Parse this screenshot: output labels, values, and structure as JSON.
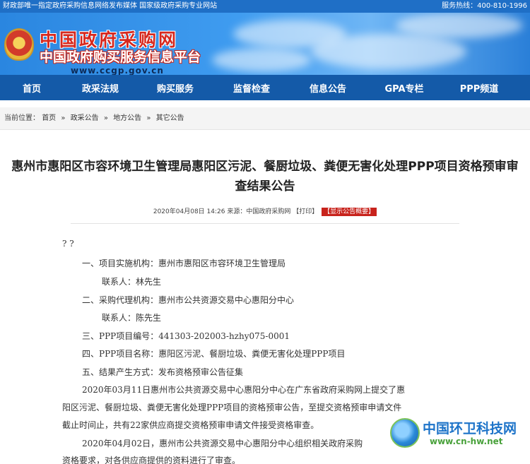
{
  "topbar": {
    "left_text": "财政部唯一指定政府采购信息网络发布媒体  国家级政府采购专业网站",
    "right_text": "服务热线：400-810-1996"
  },
  "brand": {
    "title": "中国政府采购网",
    "subtitle": "中国政府购买服务信息平台",
    "url": "www.ccgp.gov.cn"
  },
  "nav": {
    "items": [
      "首页",
      "政采法规",
      "购买服务",
      "监督检查",
      "信息公告",
      "GPA专栏",
      "PPP频道"
    ]
  },
  "breadcrumb": {
    "prefix": "当前位置：",
    "items": [
      "首页",
      "政采公告",
      "地方公告",
      "其它公告"
    ]
  },
  "article": {
    "title": "惠州市惠阳区市容环境卫生管理局惠阳区污泥、餐厨垃圾、粪便无害化处理PPP项目资格预审审查结果公告",
    "meta_date": "2020年04月08日 14:26",
    "meta_source": "来源：中国政府采购网",
    "meta_print": "【打印】",
    "meta_summary": "【显示公告概要】"
  },
  "body": {
    "l0": "? ?",
    "l1": "一、项目实施机构：惠州市惠阳区市容环境卫生管理局",
    "l2": "联系人：林先生",
    "l3": "二、采购代理机构：惠州市公共资源交易中心惠阳分中心",
    "l4": "联系人：陈先生",
    "l5": "三、PPP项目编号：441303-202003-hzhy075-0001",
    "l6": "四、PPP项目名称：惠阳区污泥、餐厨垃圾、粪便无害化处理PPP项目",
    "l7": "五、结果产生方式：发布资格预审公告征集",
    "l8": "2020年03月11日惠州市公共资源交易中心惠阳分中心在广东省政府采购网上提交了惠",
    "l9": "阳区污泥、餐厨垃圾、粪便无害化处理PPP项目的资格预审公告，至提交资格预审申请文件",
    "l10": "截止时间止，共有22家供应商提交资格预审申请文件接受资格审查。",
    "l11": "2020年04月02日，惠州市公共资源交易中心惠阳分中心组织相关政府采购",
    "l12": "资格要求，对各供应商提供的资料进行了审查。"
  },
  "watermark": {
    "name": "中国环卫科技网",
    "url": "www.cn-hw.net"
  }
}
